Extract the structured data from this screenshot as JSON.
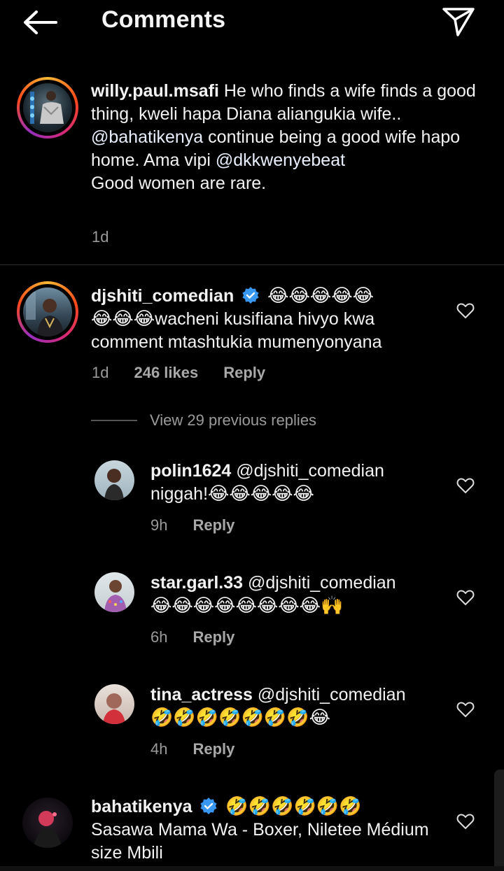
{
  "header": {
    "title": "Comments",
    "back_icon": "arrow-left-icon",
    "send_icon": "paper-plane-icon"
  },
  "caption": {
    "username": "willy.paul.msafi",
    "text_1": " He who finds a wife finds a good thing, kweli  hapa Diana aliangukia wife.. ",
    "mention_1": "@bahatikenya",
    "text_2": " continue being a good wife hapo home. Ama vipi ",
    "mention_2": "@dkkwenyebeat",
    "text_3": "Good women are rare.",
    "time": "1d"
  },
  "comments": [
    {
      "username": "djshiti_comedian",
      "verified": true,
      "emoji_1": "😂😂😂😂😂",
      "emoji_2": "😂😂😂",
      "text": "wacheni kusifiana hivyo kwa comment mtashtukia mumenyonyana",
      "time": "1d",
      "likes": "246 likes",
      "reply": "Reply"
    }
  ],
  "view_previous": "View 29 previous replies",
  "replies": [
    {
      "username": "polin1624",
      "mention": "@djshiti_comedian",
      "text": "niggah!",
      "emoji": "😂😂😂😂😂",
      "time": "9h",
      "reply": "Reply"
    },
    {
      "username": "star.garl.33",
      "mention": "@djshiti_comedian",
      "text": "",
      "emoji": "😂😂😂😂😂😂😂😂🙌",
      "time": "6h",
      "reply": "Reply"
    },
    {
      "username": "tina_actress",
      "mention": "@djshiti_comedian",
      "text": "",
      "emoji": "🤣🤣🤣🤣🤣🤣🤣😂",
      "time": "4h",
      "reply": "Reply"
    }
  ],
  "last_comment": {
    "username": "bahatikenya",
    "verified": true,
    "emoji": "🤣🤣🤣🤣🤣🤣",
    "text": "Sasawa Mama Wa - Boxer, Niletee Médium size Mbili"
  },
  "colors": {
    "background": "#000000",
    "verified_blue": "#3897f0",
    "muted": "#9a9a9a"
  }
}
